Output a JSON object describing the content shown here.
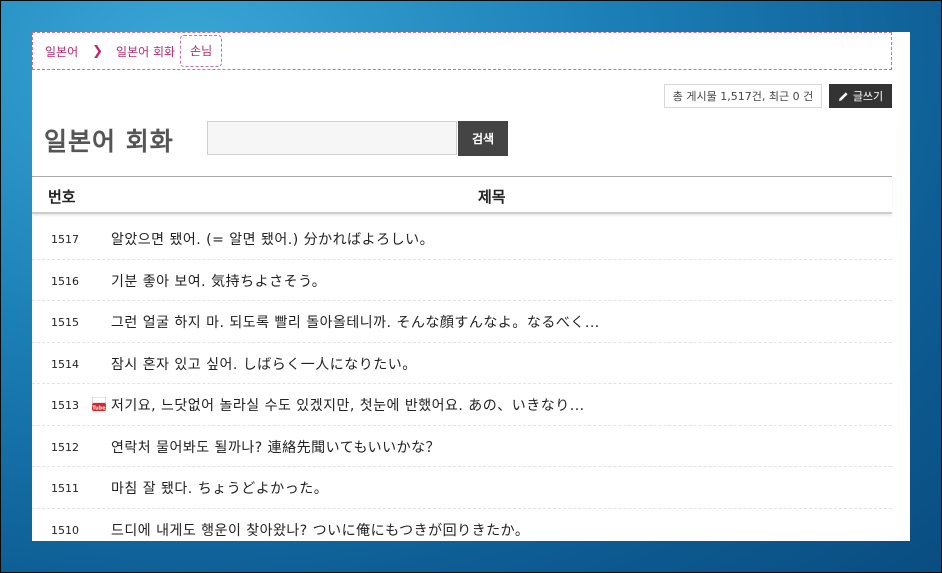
{
  "breadcrumb": {
    "items": [
      "일본어",
      "일본어 회화",
      "손님"
    ]
  },
  "header": {
    "post_count_text": "총 게시물 1,517건, 최근 0 건",
    "write_label": "글쓰기"
  },
  "board": {
    "title": "일본어 회화",
    "search_placeholder": "",
    "search_label": "검색"
  },
  "table": {
    "columns": {
      "number": "번호",
      "title": "제목"
    },
    "rows": [
      {
        "num": "1517",
        "title": "알았으면 됐어. (= 알면 됐어.) 分かればよろしい。",
        "has_video": false
      },
      {
        "num": "1516",
        "title": "기분 좋아 보여. 気持ちよさそう。",
        "has_video": false
      },
      {
        "num": "1515",
        "title": "그런 얼굴 하지 마. 되도록 빨리 돌아올테니까. そんな顔すんなよ。なるべく...",
        "has_video": false
      },
      {
        "num": "1514",
        "title": "잠시 혼자 있고 싶어. しばらく一人になりたい。",
        "has_video": false
      },
      {
        "num": "1513",
        "title": "저기요, 느닷없어 놀라실 수도 있겠지만, 첫눈에 반했어요. あの、いきなり...",
        "has_video": true
      },
      {
        "num": "1512",
        "title": "연락처 물어봐도 될까나? 連絡先聞いてもいいかな？",
        "has_video": false
      },
      {
        "num": "1511",
        "title": "마침 잘 됐다. ちょうどよかった。",
        "has_video": false
      },
      {
        "num": "1510",
        "title": "드디에 내게도 행운이 찾아왔나? ついに俺にもつきが回りきたか。",
        "has_video": false
      }
    ]
  },
  "colors": {
    "accent": "#c0266e",
    "button_dark": "#333333",
    "page_bg": "#1b7fb6"
  },
  "icons": {
    "write": "pencil-icon",
    "breadcrumb_sep": "chevron-right-icon",
    "video": "youtube-icon"
  }
}
